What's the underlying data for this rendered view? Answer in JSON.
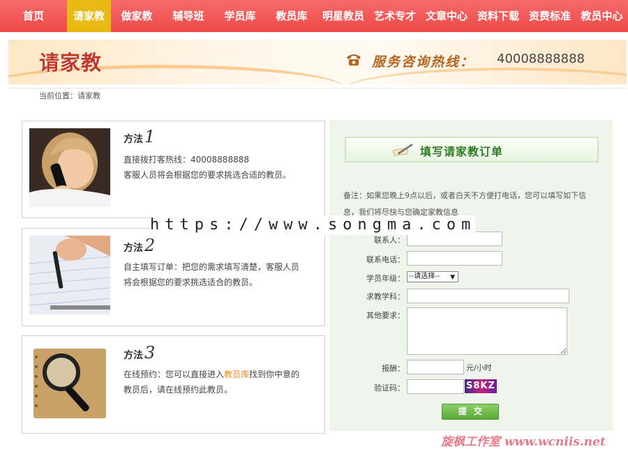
{
  "nav": {
    "items": [
      "首页",
      "请家教",
      "做家教",
      "辅导班",
      "学员库",
      "教员库",
      "明星教员",
      "艺术专才",
      "文章中心",
      "资料下载",
      "资费标准",
      "教员中心"
    ],
    "active_index": 1
  },
  "banner": {
    "title": "请家教",
    "hotline_label": "服务咨询热线：",
    "hotline_number": "40008888888",
    "icon": "phone-icon"
  },
  "breadcrumb": "当前位置：请家教",
  "methods": [
    {
      "title_prefix": "方法",
      "title_num": "1",
      "lines": [
        "直接拨打客热线：40008888888",
        "客服人员将会根据您的要求挑选合适的教员。"
      ]
    },
    {
      "title_prefix": "方法",
      "title_num": "2",
      "lines": [
        "自主填写订单：把您的需求填写清楚，客服人员",
        "将会根据您的要求挑选适合的教员。"
      ]
    },
    {
      "title_prefix": "方法",
      "title_num": "3",
      "line1_before": "在线预约：您可以直接进入",
      "line1_link": "教员库",
      "line1_after": "找到你中意的",
      "line2": "教员后，请在线预约此教员。"
    }
  ],
  "form": {
    "title": "填写请家教订单",
    "icon": "pen-icon",
    "note_line1": "备注：如果您晚上9点以后，或者白天不方便打电话，您可以填写如下信",
    "note_line2": "息，我们将尽快与您确定家教信息",
    "labels": {
      "contact": "联系人：",
      "phone": "联系电话：",
      "grade": "学员年级：",
      "subject": "求教学科：",
      "other": "其他要求：",
      "pay": "报酬：",
      "captcha": "验证码："
    },
    "grade_selected": "--请选择--",
    "pay_unit": "元/小时",
    "captcha_text": "S8KZ",
    "submit_label": "提交"
  },
  "watermark_url": "https://www.songma.com",
  "watermark_bottom": "旋枫工作室 www.wcniis.net",
  "colors": {
    "nav_bg": "#ef4a4a",
    "nav_active": "#e8b813",
    "form_title": "#2f7d25",
    "submit_bg": "#5aa83a",
    "link": "#f08a1c"
  }
}
